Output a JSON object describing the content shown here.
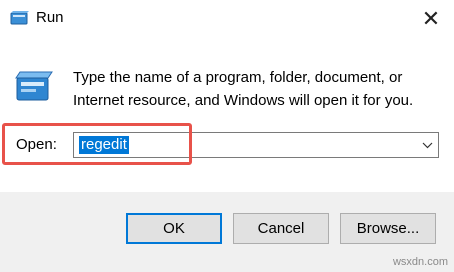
{
  "window": {
    "title": "Run",
    "close_glyph": "✕"
  },
  "icons": {
    "app": "run-app-icon",
    "dialog": "run-dialog-icon",
    "dropdown": "chevron-down-icon",
    "close": "close-icon"
  },
  "description": {
    "line1": "Type the name of a program, folder, document, or",
    "line2": "Internet resource, and Windows will open it for you."
  },
  "open_field": {
    "label": "Open:",
    "value": "regedit"
  },
  "buttons": {
    "ok": "OK",
    "cancel": "Cancel",
    "browse": "Browse..."
  },
  "watermark": "wsxdn.com",
  "colors": {
    "selection": "#0078d7",
    "highlight_box": "#e8524a",
    "footer_bg": "#f0f0f0"
  }
}
